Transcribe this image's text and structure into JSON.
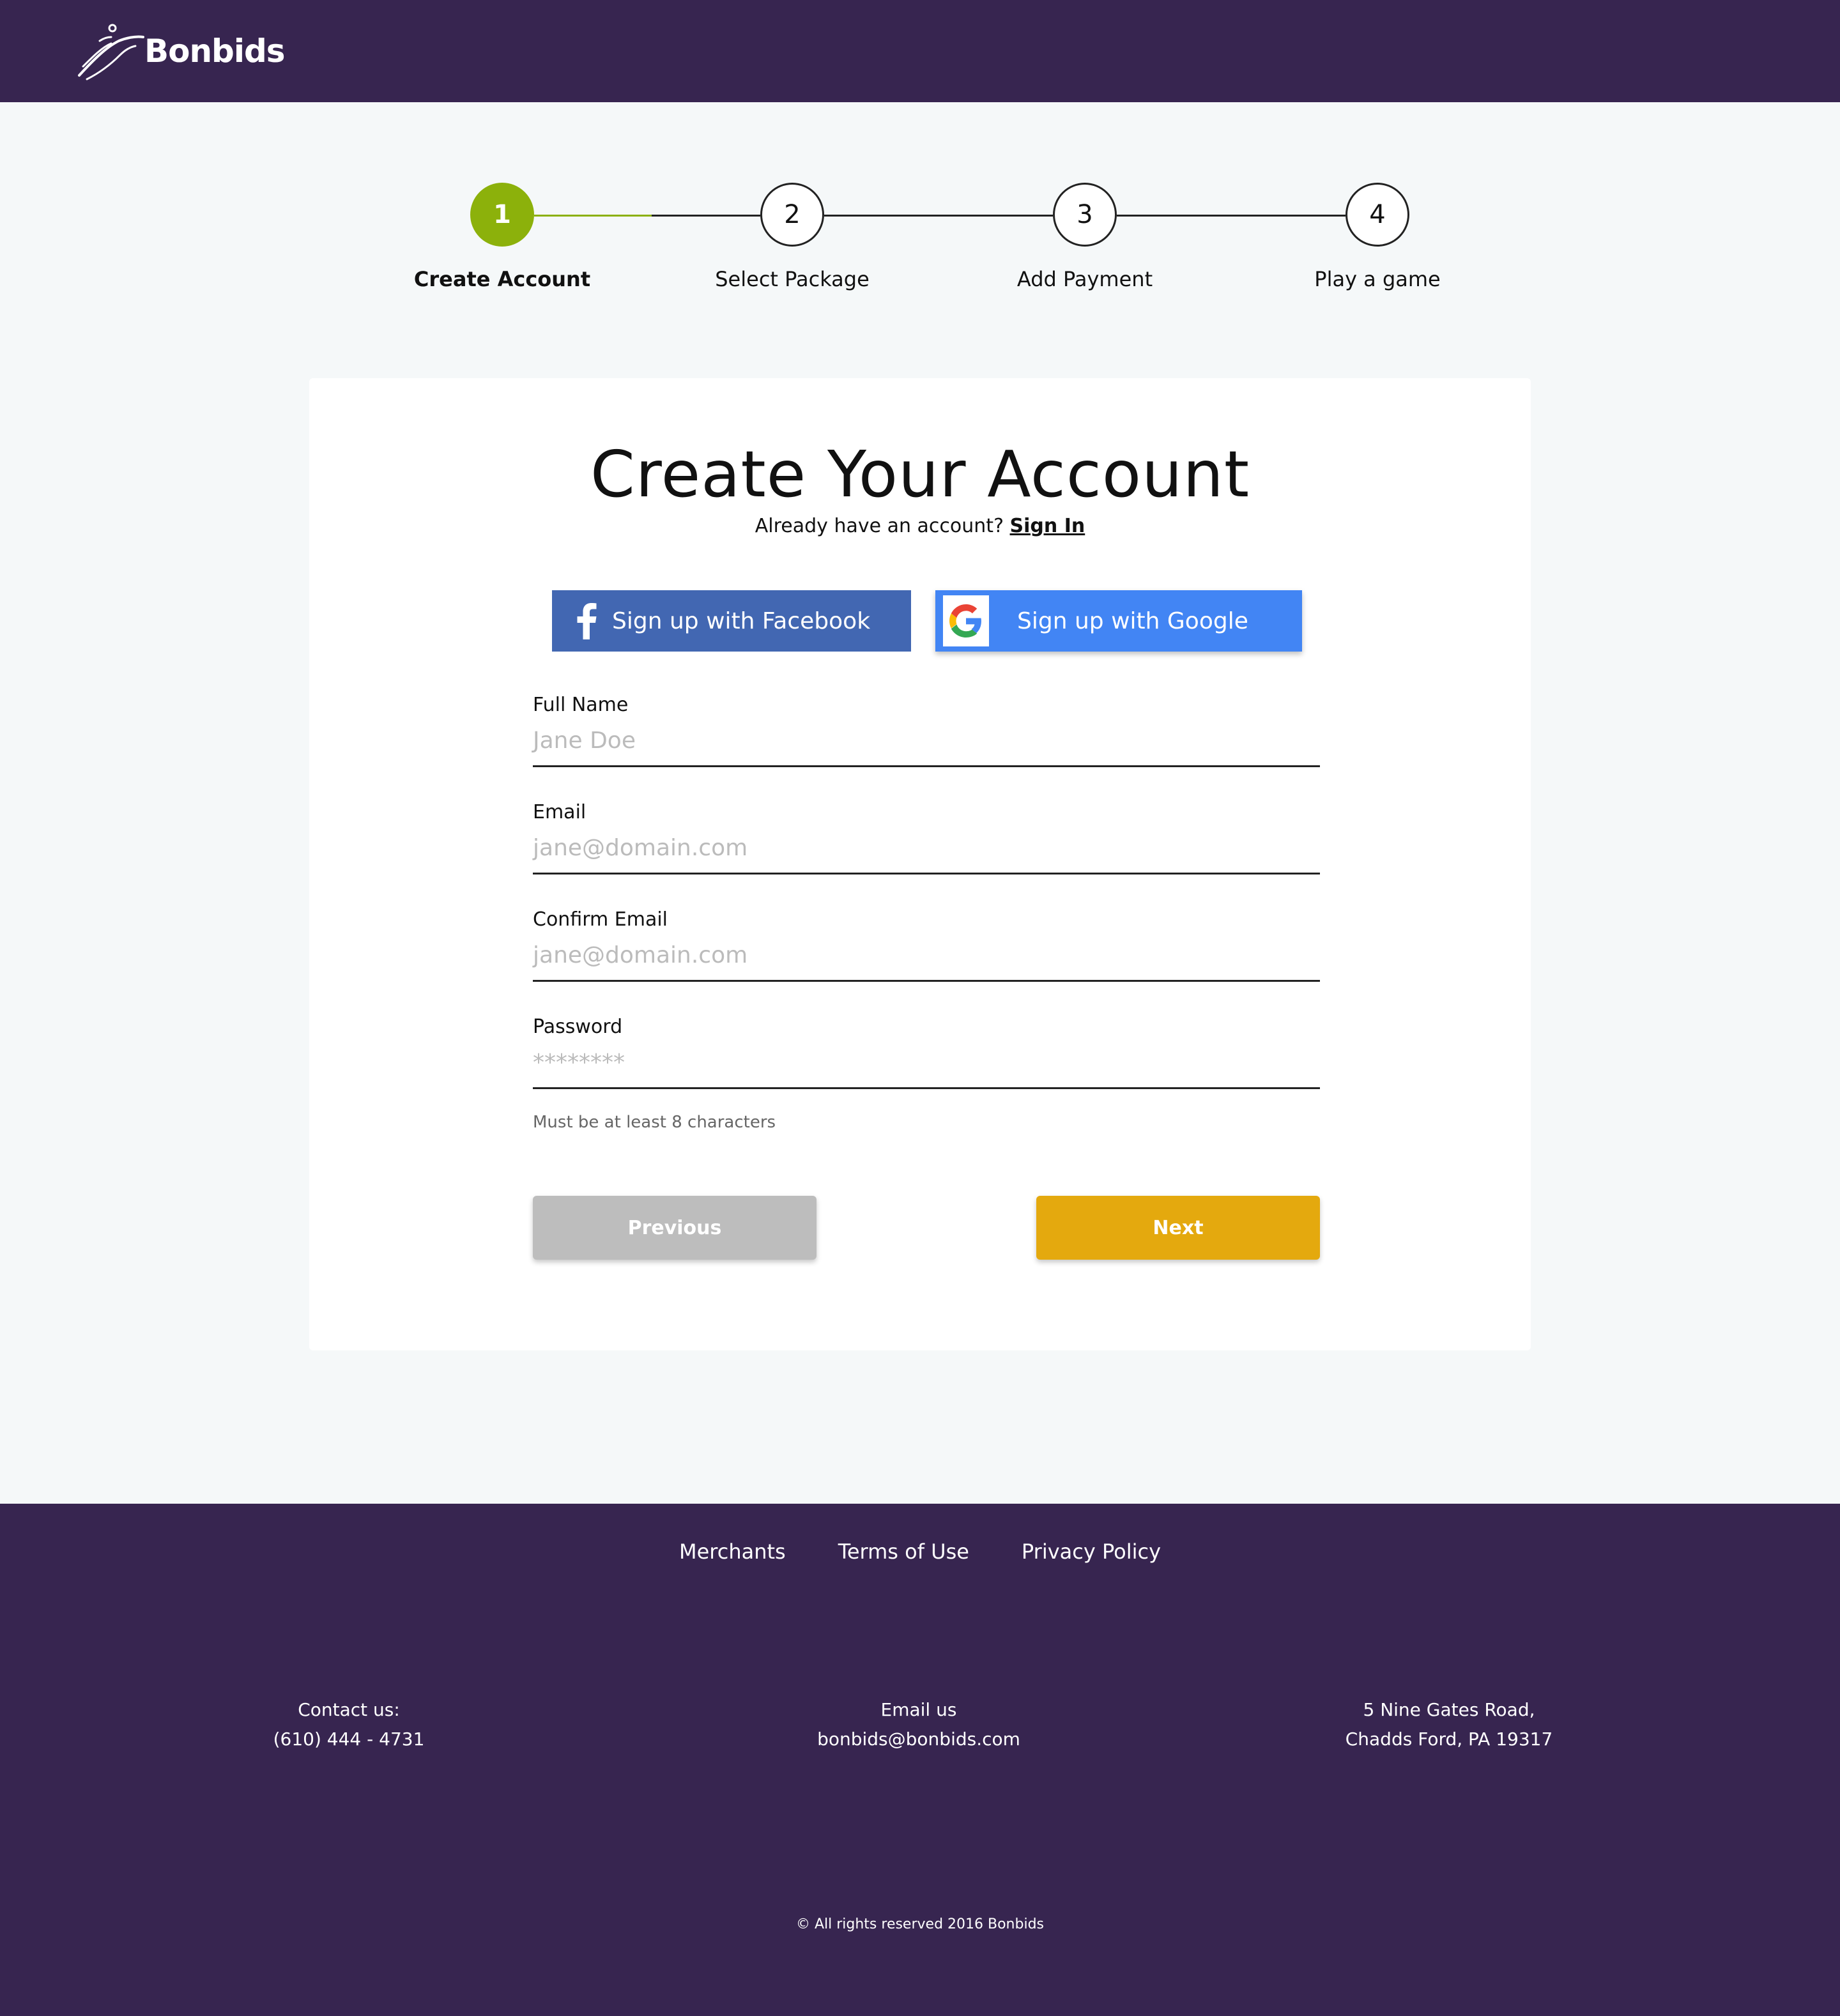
{
  "header": {
    "brand": "Bonbids",
    "bg_color": "#372550"
  },
  "stepper": {
    "current_step": 1,
    "steps": [
      {
        "number": "1",
        "label": "Create Account"
      },
      {
        "number": "2",
        "label": "Select Package"
      },
      {
        "number": "3",
        "label": "Add Payment"
      },
      {
        "number": "4",
        "label": "Play a game"
      }
    ],
    "active_color": "#8cb10b"
  },
  "form": {
    "title": "Create Your Account",
    "signin_prompt": "Already have an account?",
    "signin_link": "Sign In",
    "facebook_button": "Sign up with Facebook",
    "google_button": "Sign up with Google",
    "fields": [
      {
        "label": "Full Name",
        "placeholder": "Jane Doe"
      },
      {
        "label": "Email",
        "placeholder": "jane@domain.com"
      },
      {
        "label": "Confirm Email",
        "placeholder": "jane@domain.com"
      },
      {
        "label": "Password",
        "placeholder": "********"
      }
    ],
    "password_hint": "Must be at least 8 characters",
    "previous_button": "Previous",
    "next_button": "Next",
    "colors": {
      "facebook": "#4267b2",
      "google": "#4285f4",
      "next": "#e4a90e",
      "previous": "#bdbdbd"
    }
  },
  "footer": {
    "links": [
      "Merchants",
      "Terms of Use",
      "Privacy Policy"
    ],
    "contact": {
      "title": "Contact us:",
      "value": "(610) 444 - 4731"
    },
    "email": {
      "title": "Email us",
      "value": "bonbids@bonbids.com"
    },
    "address": {
      "line1": "5 Nine Gates Road,",
      "line2": "Chadds Ford, PA 19317"
    },
    "copyright": "© All rights reserved 2016 Bonbids"
  }
}
